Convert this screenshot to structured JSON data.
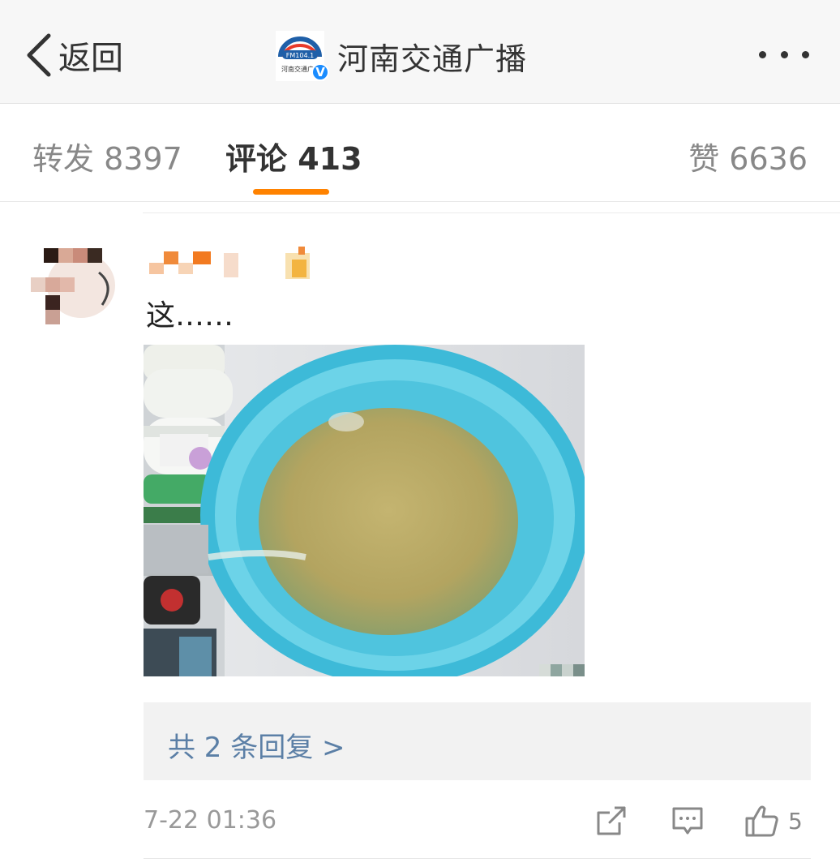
{
  "nav": {
    "back_label": "返回",
    "title": "河南交通广播",
    "logo_text": "FM104.1",
    "logo_caption": "河南交通广",
    "verified_mark": "V"
  },
  "tabs": {
    "repost": "转发 8397",
    "comment": "评论 413",
    "like": "赞 6636",
    "active": "comment",
    "indicator_color": "#ff8200"
  },
  "comment": {
    "text": "这……",
    "replies_label": "共 2 条回复 >",
    "timestamp": "7-22 01:36",
    "like_count": "5"
  },
  "icons": {
    "back": "chevron-left-icon",
    "more": "more-dots-icon",
    "share": "share-icon",
    "comment": "comment-icon",
    "like": "thumbs-up-icon",
    "badge": "member-badge-icon"
  },
  "colors": {
    "link": "#5b7fa6",
    "accent": "#ff8200",
    "verified": "#1a8cff"
  }
}
